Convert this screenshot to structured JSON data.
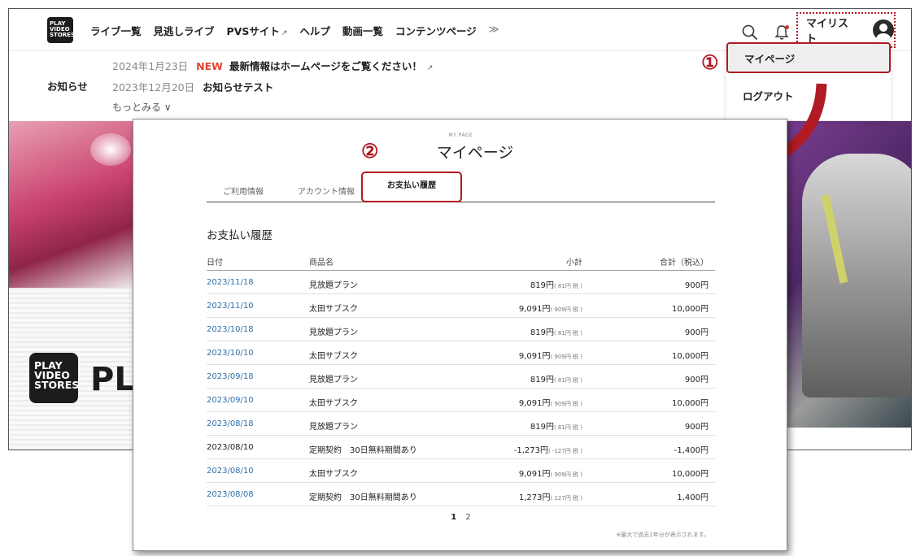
{
  "nav": {
    "logo_lines": [
      "PLAY",
      "VIDEO",
      "STORES"
    ],
    "links": [
      "ライブ一覧",
      "見逃しライブ",
      "PVSサイト",
      "ヘルプ",
      "動画一覧",
      "コンテンツページ"
    ],
    "more": "≫",
    "external_icon": "↗",
    "mylist": "マイリスト"
  },
  "news": {
    "label": "お知らせ",
    "items": [
      {
        "date": "2024年1月23日",
        "badge": "NEW",
        "text": "最新情報はホームページをご覧ください！"
      },
      {
        "date": "2023年12月20日",
        "text": "お知らせテスト"
      }
    ],
    "more": "もっとみる ∨"
  },
  "dropdown": {
    "mypage": "マイページ",
    "logout": "ログアウト"
  },
  "callouts": [
    "①",
    "②"
  ],
  "hero": {
    "logo_lines": [
      "PLAY",
      "VIDEO",
      "STORES"
    ],
    "partial_title": "PL"
  },
  "panel": {
    "small_title": "MY PAGE",
    "title": "マイページ",
    "tabs": [
      "ご利用情報",
      "アカウント情報",
      "お支払い履歴"
    ],
    "section_title": "お支払い履歴",
    "columns": [
      "日付",
      "商品名",
      "小計",
      "合計（税込）"
    ],
    "rows": [
      {
        "date": "2023/11/18",
        "name": "見放題プラン",
        "sub": "819円",
        "tax": "( 81円 税 )",
        "total": "900円",
        "link": true
      },
      {
        "date": "2023/11/10",
        "name": "太田サブスク",
        "sub": "9,091円",
        "tax": "( 909円 税 )",
        "total": "10,000円",
        "link": true
      },
      {
        "date": "2023/10/18",
        "name": "見放題プラン",
        "sub": "819円",
        "tax": "( 81円 税 )",
        "total": "900円",
        "link": true
      },
      {
        "date": "2023/10/10",
        "name": "太田サブスク",
        "sub": "9,091円",
        "tax": "( 909円 税 )",
        "total": "10,000円",
        "link": true
      },
      {
        "date": "2023/09/18",
        "name": "見放題プラン",
        "sub": "819円",
        "tax": "( 81円 税 )",
        "total": "900円",
        "link": true
      },
      {
        "date": "2023/09/10",
        "name": "太田サブスク",
        "sub": "9,091円",
        "tax": "( 909円 税 )",
        "total": "10,000円",
        "link": true
      },
      {
        "date": "2023/08/18",
        "name": "見放題プラン",
        "sub": "819円",
        "tax": "( 81円 税 )",
        "total": "900円",
        "link": true
      },
      {
        "date": "2023/08/10",
        "name": "定期契約　30日無料期間あり",
        "sub": "-1,273円",
        "tax": "( -127円 税 )",
        "total": "-1,400円",
        "link": false
      },
      {
        "date": "2023/08/10",
        "name": "太田サブスク",
        "sub": "9,091円",
        "tax": "( 909円 税 )",
        "total": "10,000円",
        "link": true
      },
      {
        "date": "2023/08/08",
        "name": "定期契約　30日無料期間あり",
        "sub": "1,273円",
        "tax": "( 127円 税 )",
        "total": "1,400円",
        "link": true
      }
    ],
    "pager": {
      "current": "1",
      "next": "2"
    },
    "note": "※最大で過去1年分が表示されます。"
  },
  "colors": {
    "accent_red": "#b01b24",
    "link_blue": "#2f6fa8",
    "new_badge": "#e0452f"
  }
}
